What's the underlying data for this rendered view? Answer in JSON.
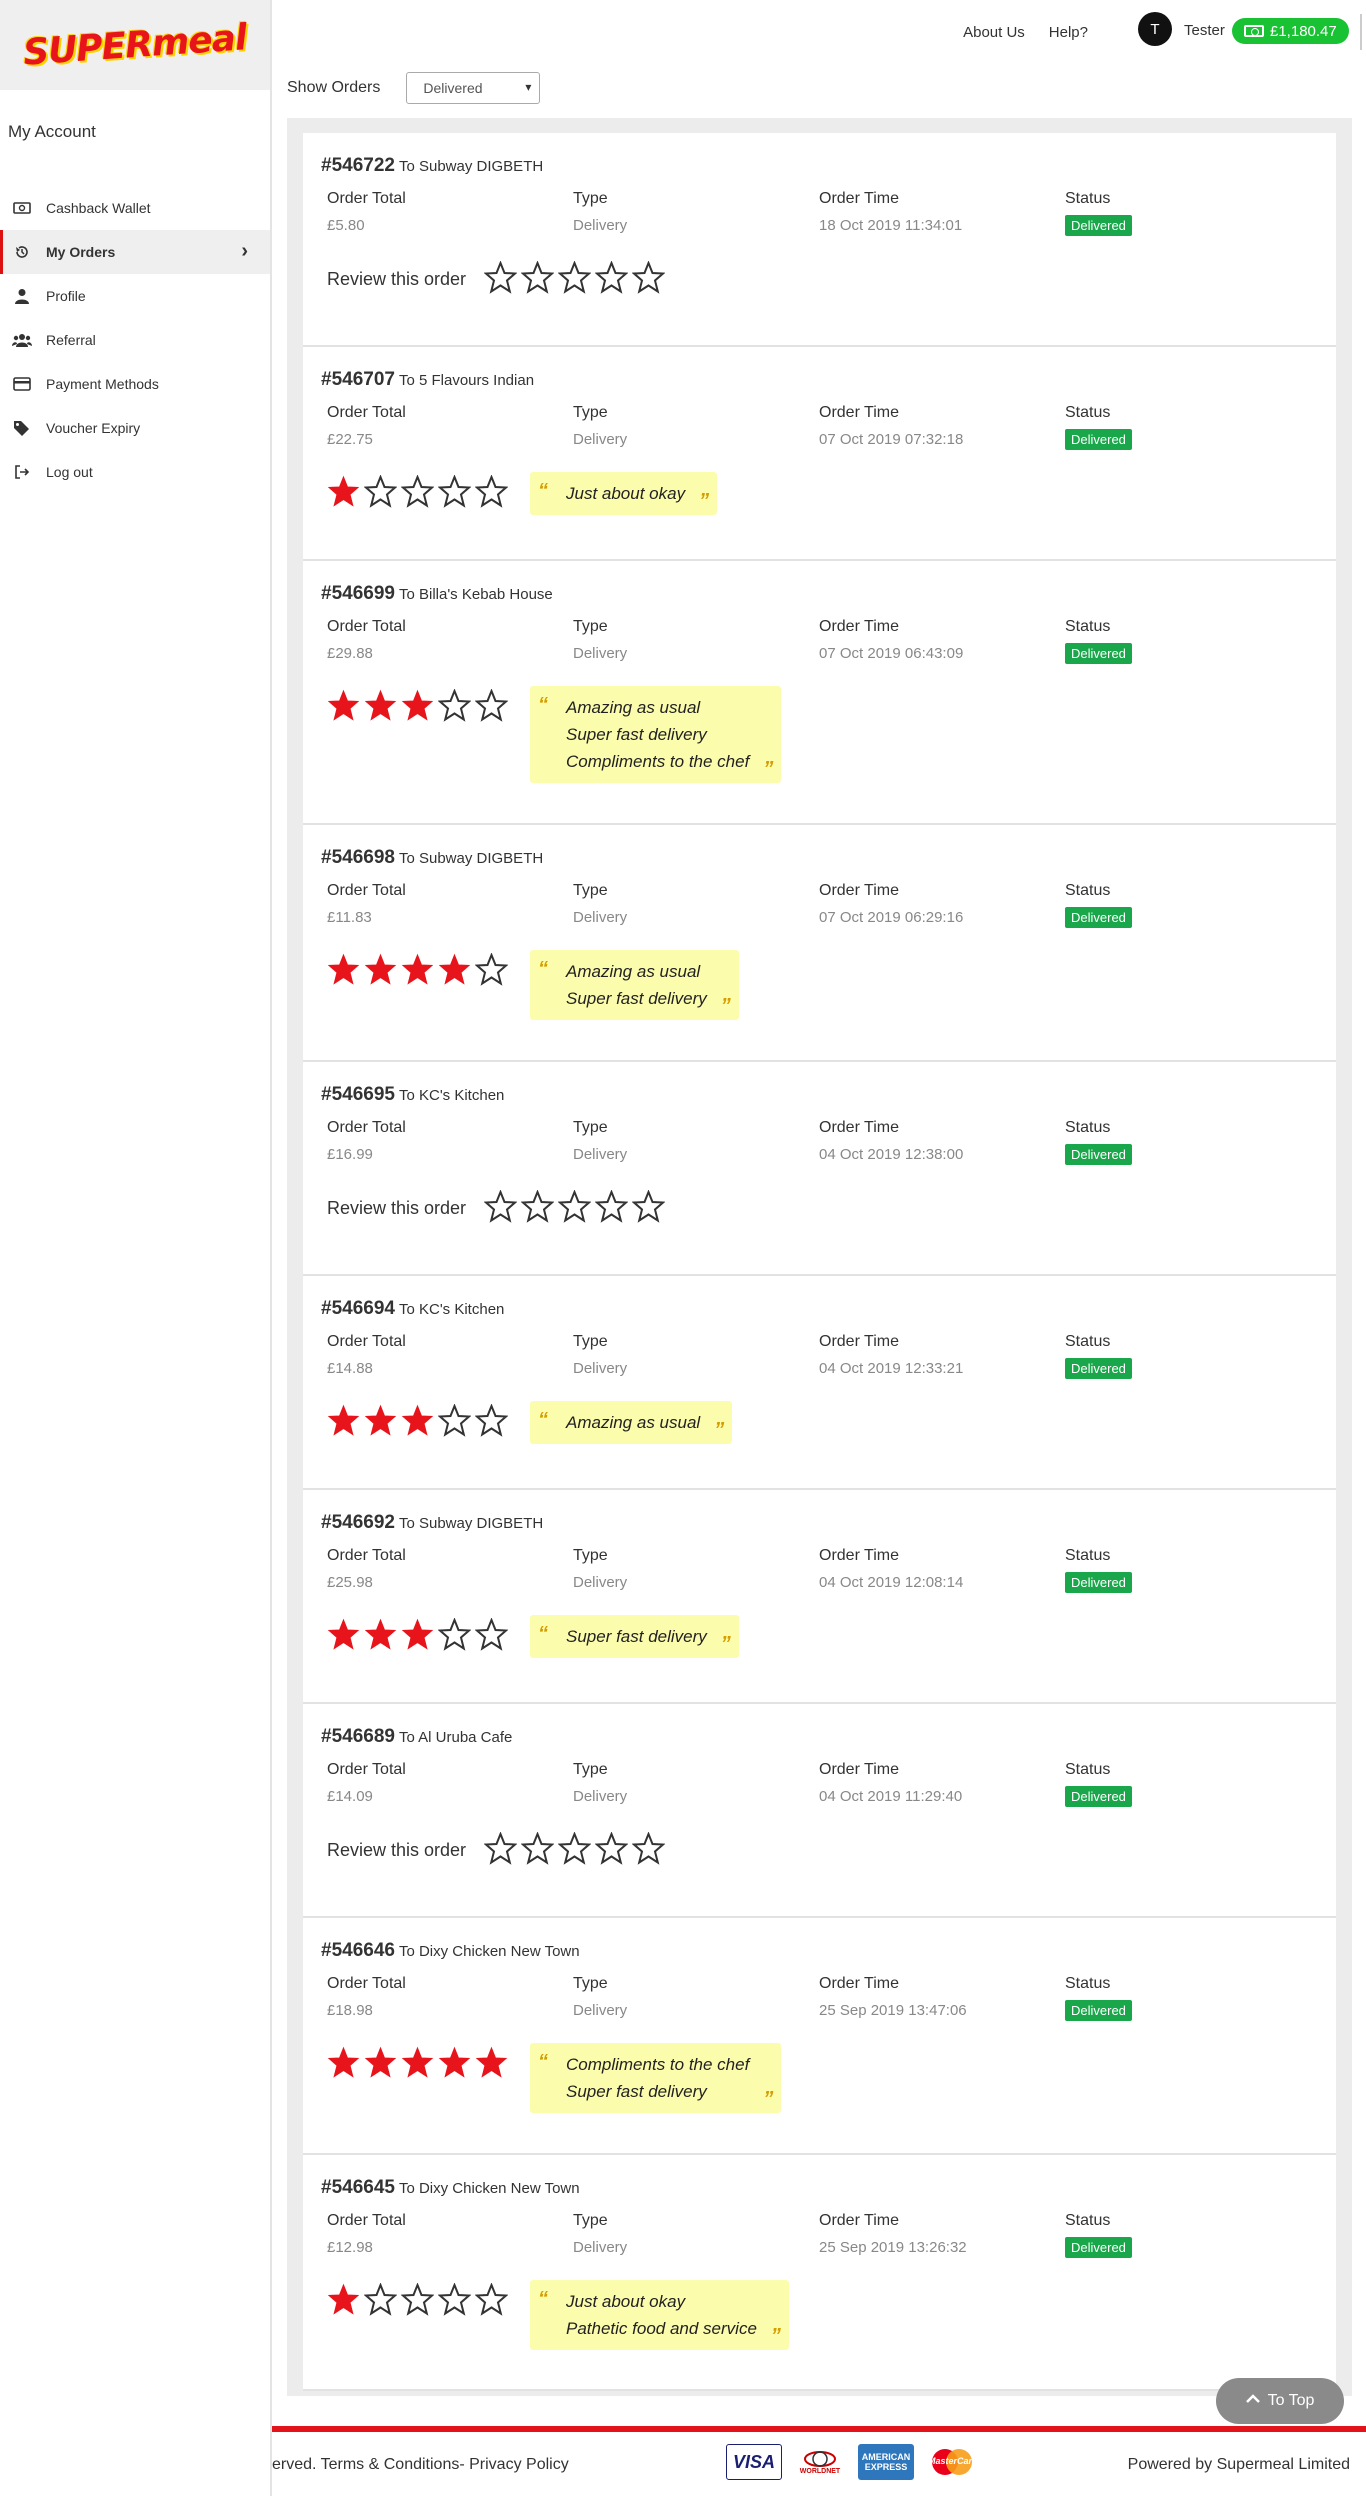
{
  "brand": {
    "logo_text": "SUPERmeal"
  },
  "sidebar": {
    "title": "My Account",
    "items": [
      {
        "label": "Cashback Wallet",
        "icon": "cash-icon",
        "active": false
      },
      {
        "label": "My Orders",
        "icon": "history-icon",
        "active": true
      },
      {
        "label": "Profile",
        "icon": "user-icon",
        "active": false
      },
      {
        "label": "Referral",
        "icon": "users-icon",
        "active": false
      },
      {
        "label": "Payment Methods",
        "icon": "credit-card-icon",
        "active": false
      },
      {
        "label": "Voucher Expiry",
        "icon": "tags-icon",
        "active": false
      },
      {
        "label": "Log out",
        "icon": "sign-out-icon",
        "active": false
      }
    ]
  },
  "header": {
    "about": "About Us",
    "help": "Help?",
    "avatar_initial": "T",
    "username": "Tester",
    "wallet_balance": "£1,180.47"
  },
  "filter": {
    "label": "Show Orders",
    "selected": "Delivered"
  },
  "labels": {
    "order_total": "Order Total",
    "type": "Type",
    "order_time": "Order Time",
    "status": "Status",
    "review_prompt": "Review this order"
  },
  "colors": {
    "star_filled": "#e8141b",
    "status_green": "#1aa64a",
    "wallet_green": "#19c232"
  },
  "orders": [
    {
      "id": "#546722",
      "to": "To Subway DIGBETH",
      "total": "£5.80",
      "type": "Delivery",
      "time": "18 Oct 2019 11:34:01",
      "status": "Delivered",
      "rating": 0,
      "comments": []
    },
    {
      "id": "#546707",
      "to": "To 5 Flavours Indian",
      "total": "£22.75",
      "type": "Delivery",
      "time": "07 Oct 2019 07:32:18",
      "status": "Delivered",
      "rating": 1,
      "comments": [
        "Just about okay"
      ]
    },
    {
      "id": "#546699",
      "to": "To Billa's Kebab House",
      "total": "£29.88",
      "type": "Delivery",
      "time": "07 Oct 2019 06:43:09",
      "status": "Delivered",
      "rating": 3,
      "comments": [
        "Amazing as usual",
        "Super fast delivery",
        "Compliments to the chef"
      ]
    },
    {
      "id": "#546698",
      "to": "To Subway DIGBETH",
      "total": "£11.83",
      "type": "Delivery",
      "time": "07 Oct 2019 06:29:16",
      "status": "Delivered",
      "rating": 4,
      "comments": [
        "Amazing as usual",
        "Super fast delivery"
      ]
    },
    {
      "id": "#546695",
      "to": "To KC's Kitchen",
      "total": "£16.99",
      "type": "Delivery",
      "time": "04 Oct 2019 12:38:00",
      "status": "Delivered",
      "rating": 0,
      "comments": []
    },
    {
      "id": "#546694",
      "to": "To KC's Kitchen",
      "total": "£14.88",
      "type": "Delivery",
      "time": "04 Oct 2019 12:33:21",
      "status": "Delivered",
      "rating": 3,
      "comments": [
        "Amazing as usual"
      ]
    },
    {
      "id": "#546692",
      "to": "To Subway DIGBETH",
      "total": "£25.98",
      "type": "Delivery",
      "time": "04 Oct 2019 12:08:14",
      "status": "Delivered",
      "rating": 3,
      "comments": [
        "Super fast delivery"
      ]
    },
    {
      "id": "#546689",
      "to": "To Al Uruba Cafe",
      "total": "£14.09",
      "type": "Delivery",
      "time": "04 Oct 2019 11:29:40",
      "status": "Delivered",
      "rating": 0,
      "comments": []
    },
    {
      "id": "#546646",
      "to": "To Dixy Chicken New Town",
      "total": "£18.98",
      "type": "Delivery",
      "time": "25 Sep 2019 13:47:06",
      "status": "Delivered",
      "rating": 5,
      "comments": [
        "Compliments to the chef",
        "Super fast delivery"
      ]
    },
    {
      "id": "#546645",
      "to": "To Dixy Chicken New Town",
      "total": "£12.98",
      "type": "Delivery",
      "time": "25 Sep 2019 13:26:32",
      "status": "Delivered",
      "rating": 1,
      "comments": [
        "Just about okay",
        "Pathetic food and service"
      ]
    }
  ],
  "to_top": "To Top",
  "footer": {
    "copyright": "erved.",
    "terms": "Terms & Conditions",
    "privacy": "- Privacy Policy",
    "payment_logos": [
      "VISA",
      "WORLDNET",
      "AMERICAN EXPRESS",
      "MasterCard"
    ],
    "powered_by": "Powered by Supermeal Limited"
  }
}
